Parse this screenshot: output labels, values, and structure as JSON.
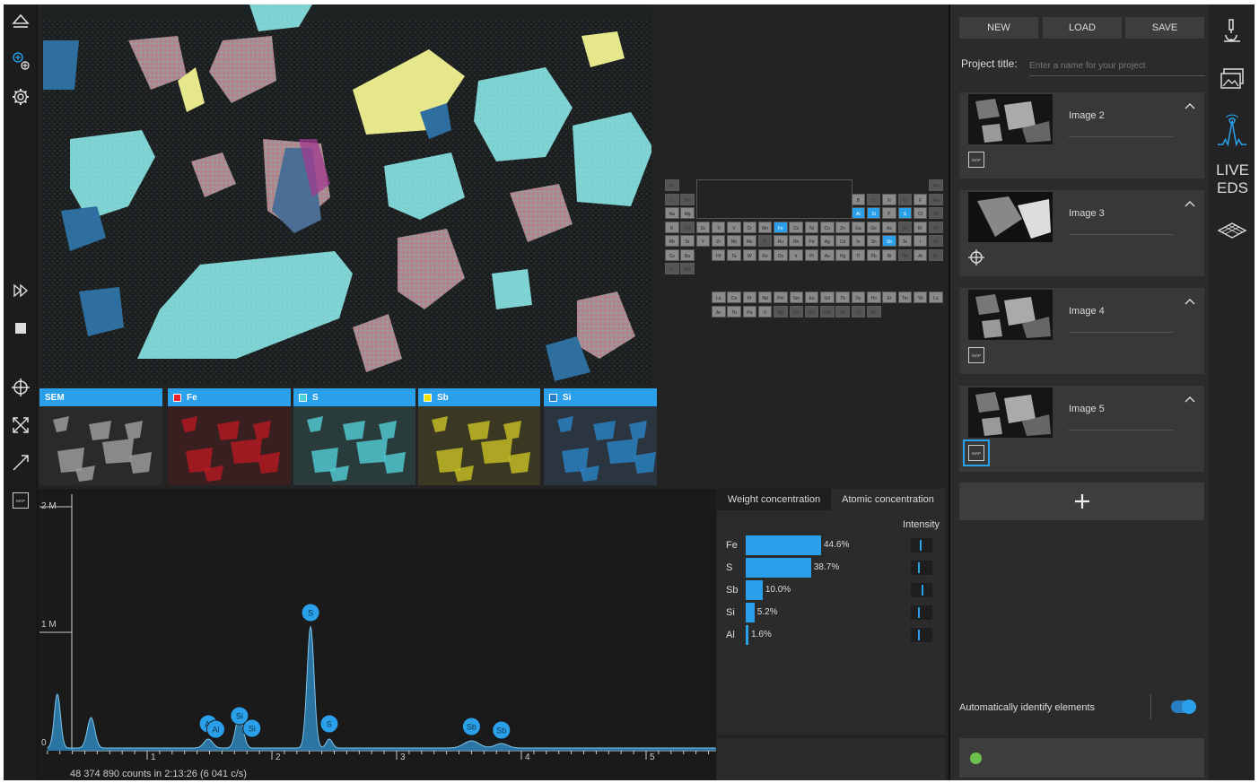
{
  "project": {
    "new_label": "NEW",
    "load_label": "LOAD",
    "save_label": "SAVE",
    "title_label": "Project title:",
    "title_placeholder": "Enter a name for your project"
  },
  "images": [
    {
      "name": "Image 2",
      "badge": "map"
    },
    {
      "name": "Image 3",
      "badge": "crosshair"
    },
    {
      "name": "Image 4",
      "badge": "map"
    },
    {
      "name": "Image 5",
      "badge": "map",
      "selected": true
    }
  ],
  "map_badge_text": "MAP",
  "map_tiles": [
    {
      "label": "SEM",
      "swatch": null
    },
    {
      "label": "Fe",
      "swatch": "#e8212a"
    },
    {
      "label": "S",
      "swatch": "#4fd0d8"
    },
    {
      "label": "Sb",
      "swatch": "#f2e200"
    },
    {
      "label": "Si",
      "swatch": "#2a7fc0"
    }
  ],
  "concentration": {
    "tab_weight": "Weight concentration",
    "tab_atomic": "Atomic concentration",
    "intensity_label": "Intensity",
    "rows": [
      {
        "element": "Fe",
        "percent": "44.6%",
        "value": 44.6,
        "intensity": 0.5
      },
      {
        "element": "S",
        "percent": "38.7%",
        "value": 38.7,
        "intensity": 0.4
      },
      {
        "element": "Sb",
        "percent": "10.0%",
        "value": 10.0,
        "intensity": 0.6
      },
      {
        "element": "Si",
        "percent": "5.2%",
        "value": 5.2,
        "intensity": 0.4
      },
      {
        "element": "Al",
        "percent": "1.6%",
        "value": 1.6,
        "intensity": 0.4
      }
    ]
  },
  "spectrum": {
    "y_labels": [
      "2 M",
      "1 M",
      "0"
    ],
    "x_labels": [
      "1",
      "2",
      "3",
      "4",
      "5"
    ],
    "peak_labels": [
      "S",
      "Si",
      "Al",
      "Al",
      "Si",
      "S",
      "Sb",
      "Sb"
    ],
    "counts_text": "48 374 890 counts in 2:13:26 (6 041 c/s)"
  },
  "auto_identify": {
    "label": "Automatically identify elements",
    "enabled": true
  },
  "right_nav": {
    "live_line1": "LIVE",
    "live_line2": "EDS"
  },
  "colors": {
    "accent": "#2aa0ea",
    "status_ok": "#6cc24a",
    "panel_bg": "#2b2b2b"
  },
  "periodic_table": {
    "selected": [
      "Al",
      "Si",
      "S",
      "Fe",
      "Sb"
    ]
  }
}
